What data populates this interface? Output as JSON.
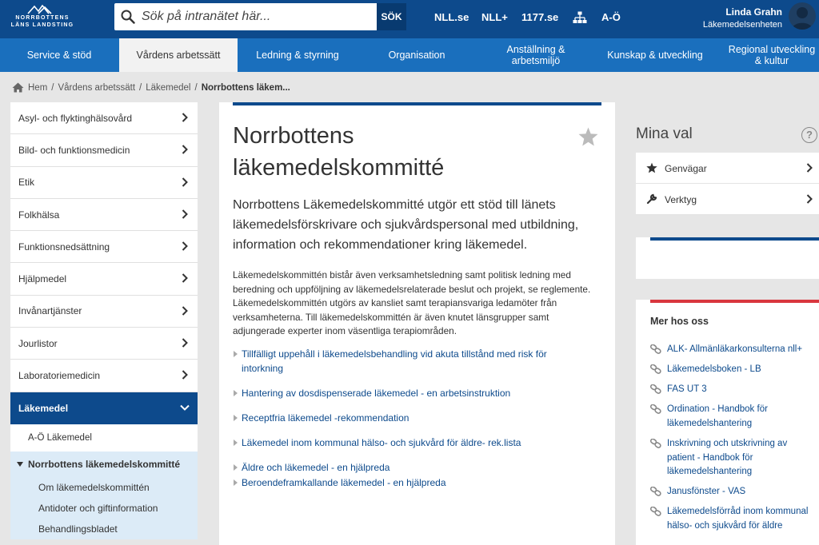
{
  "header": {
    "logo_line1": "NORRBOTTENS",
    "logo_line2": "LÄNS LANDSTING",
    "search_placeholder": "Sök på intranätet här...",
    "search_button": "SÖK",
    "links": [
      "NLL.se",
      "NLL+",
      "1177.se"
    ],
    "az_link": "A-Ö",
    "user_name": "Linda Grahn",
    "user_unit": "Läkemedelsenheten"
  },
  "nav": {
    "items": [
      {
        "label": "Service & stöd"
      },
      {
        "label": "Vårdens arbetssätt"
      },
      {
        "label": "Ledning & styrning"
      },
      {
        "label": "Organisation"
      },
      {
        "label": "Anställning & arbetsmiljö"
      },
      {
        "label": "Kunskap & utveckling"
      },
      {
        "label": "Regional utveckling & kultur"
      }
    ]
  },
  "breadcrumb": {
    "home": "Hem",
    "items": [
      "Vårdens arbetssätt",
      "Läkemedel"
    ],
    "current": "Norrbottens läkem..."
  },
  "sidebar": {
    "items": [
      {
        "label": "Asyl- och flyktinghälsovård"
      },
      {
        "label": "Bild- och funktionsmedicin"
      },
      {
        "label": "Etik"
      },
      {
        "label": "Folkhälsa"
      },
      {
        "label": "Funktionsnedsättning"
      },
      {
        "label": "Hjälpmedel"
      },
      {
        "label": "Invånartjänster"
      },
      {
        "label": "Jourlistor"
      },
      {
        "label": "Laboratoriemedicin"
      }
    ],
    "active": "Läkemedel",
    "sub": "A-Ö Läkemedel",
    "sub_active": "Norrbottens läkemedelskommitté",
    "sub_items": [
      "Om läkemedelskommittén",
      "Antidoter och giftinformation",
      "Behandlingsbladet"
    ]
  },
  "main": {
    "title": "Norrbottens läkemedelskommitté",
    "lead": "Norrbottens Läkemedelskommitté utgör ett stöd till länets läkemedelsförskrivare och sjukvårdspersonal med utbildning, information och rekommendationer kring läkemedel.",
    "body": "Läkemedelskommittén bistår även verksamhetsledning samt politisk ledning med beredning och uppföljning av läkemedelsrelaterade beslut och projekt, se reglemente. Läkemedelskommittén utgörs av kansliet samt terapiansvariga ledamöter från verksamheterna. Till läkemedelskommittén är även knutet länsgrupper samt adjungerade experter inom väsentliga terapiområden.",
    "links": [
      "Tillfälligt uppehåll i läkemedelsbehandling vid akuta tillstånd med risk för intorkning",
      "Hantering av dosdispenserade läkemedel - en arbetsinstruktion",
      "Receptfria läkemedel -rekommendation",
      "Läkemedel inom kommunal hälso- och sjukvård för äldre- rek.lista",
      "Äldre och läkemedel - en hjälpreda",
      "Beroendeframkallande läkemedel - en hjälpreda"
    ]
  },
  "mina_val": {
    "title": "Mina val",
    "help": "?",
    "items": [
      {
        "label": "Genvägar",
        "icon": "star-icon"
      },
      {
        "label": "Verktyg",
        "icon": "wrench-icon"
      }
    ]
  },
  "mer_hos_oss": {
    "title": "Mer hos oss",
    "links": [
      "ALK- Allmänläkarkonsulterna nll+",
      "Läkemedelsboken - LB",
      "FAS UT 3",
      "Ordination - Handbok för läkemedelshantering",
      "Inskrivning och utskrivning av patient - Handbok för läkemedelshantering",
      "Janusfönster - VAS",
      "Läkemedelsförråd inom kommunal hälso- och sjukvård för äldre"
    ]
  },
  "colors": {
    "header_blue": "#0d4a8c",
    "nav_blue": "#1a6fbd",
    "accent_red": "#d9363e",
    "link_blue": "#0d4a8c"
  }
}
